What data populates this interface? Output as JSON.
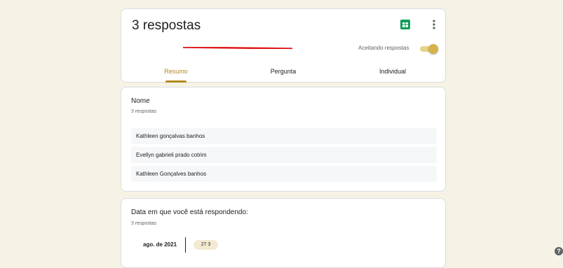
{
  "summary": {
    "title": "3 respostas",
    "accepting_label": "Aceitando respostas",
    "tabs": [
      "Resumo",
      "Pergunta",
      "Individual"
    ]
  },
  "name_question": {
    "title": "Nome",
    "count": "3 respostas",
    "responses": [
      "Kathleen gonçalvas banhos",
      "Evellyn gabrieli prado cotrim",
      "Kathleen Gonçalves banhos"
    ]
  },
  "date_question": {
    "title": "Data em que você está respondendo:",
    "count": "3 respostas",
    "month": "ago. de 2021",
    "day_chip": "27  3"
  },
  "help": {
    "label": "?"
  },
  "colors": {
    "accent": "#b08a1f",
    "sheets_green": "#0f9d58",
    "redline": "#e01b1b"
  }
}
